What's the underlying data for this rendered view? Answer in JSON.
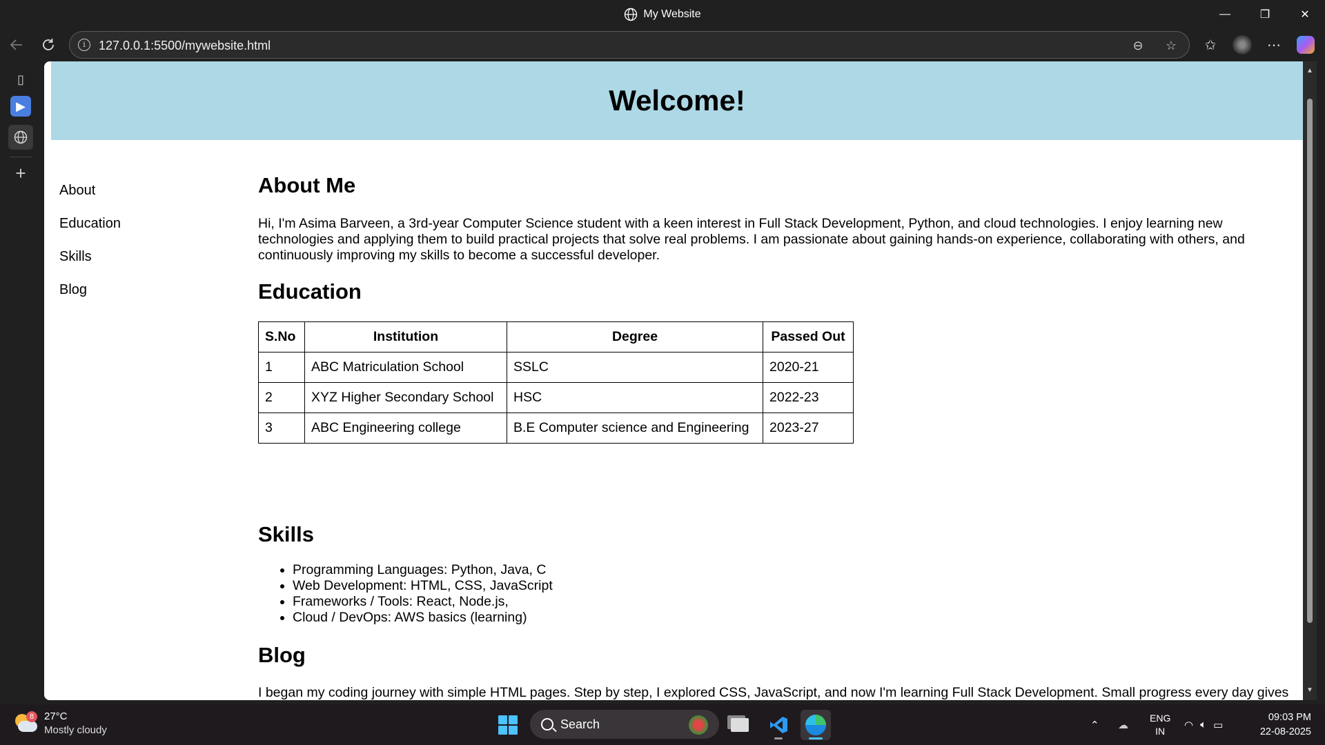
{
  "window": {
    "title": "My Website",
    "minimize": "—",
    "restore": "❐",
    "close": "✕"
  },
  "browser": {
    "url": "127.0.0.1:5500/mywebsite.html",
    "back_icon": "arrow-left-icon",
    "refresh_icon": "refresh-icon"
  },
  "page": {
    "header": {
      "title": "Welcome!"
    },
    "nav": [
      {
        "label": "About"
      },
      {
        "label": "Education"
      },
      {
        "label": "Skills"
      },
      {
        "label": "Blog"
      }
    ],
    "about": {
      "heading": "About Me",
      "text": "Hi, I'm Asima Barveen, a 3rd-year Computer Science student with a keen interest in Full Stack Development, Python, and cloud technologies. I enjoy learning new technologies and applying them to build practical projects that solve real problems. I am passionate about gaining hands-on experience, collaborating with others, and continuously improving my skills to become a successful developer."
    },
    "education": {
      "heading": "Education",
      "columns": [
        "S.No",
        "Institution",
        "Degree",
        "Passed Out"
      ],
      "rows": [
        [
          "1",
          "ABC Matriculation School",
          "SSLC",
          "2020-21"
        ],
        [
          "2",
          "XYZ Higher Secondary School",
          "HSC",
          "2022-23"
        ],
        [
          "3",
          "ABC Engineering college",
          "B.E Computer science and Engineering",
          "2023-27"
        ]
      ]
    },
    "skills": {
      "heading": "Skills",
      "items": [
        "Programming Languages: Python, Java, C",
        "Web Development: HTML, CSS, JavaScript",
        "Frameworks / Tools: React, Node.js,",
        "Cloud / DevOps: AWS basics (learning)"
      ]
    },
    "blog": {
      "heading": "Blog",
      "text": "I began my coding journey with simple HTML pages. Step by step, I explored CSS, JavaScript, and now I'm learning Full Stack Development. Small progress every day gives me confidence!"
    },
    "header_color": "#add8e6"
  },
  "taskbar": {
    "weather": {
      "temp": "27°C",
      "desc": "Mostly cloudy",
      "badge": "8"
    },
    "search_label": "Search",
    "lang": {
      "line1": "ENG",
      "line2": "IN"
    },
    "clock": {
      "time": "09:03 PM",
      "date": "22-08-2025"
    }
  }
}
